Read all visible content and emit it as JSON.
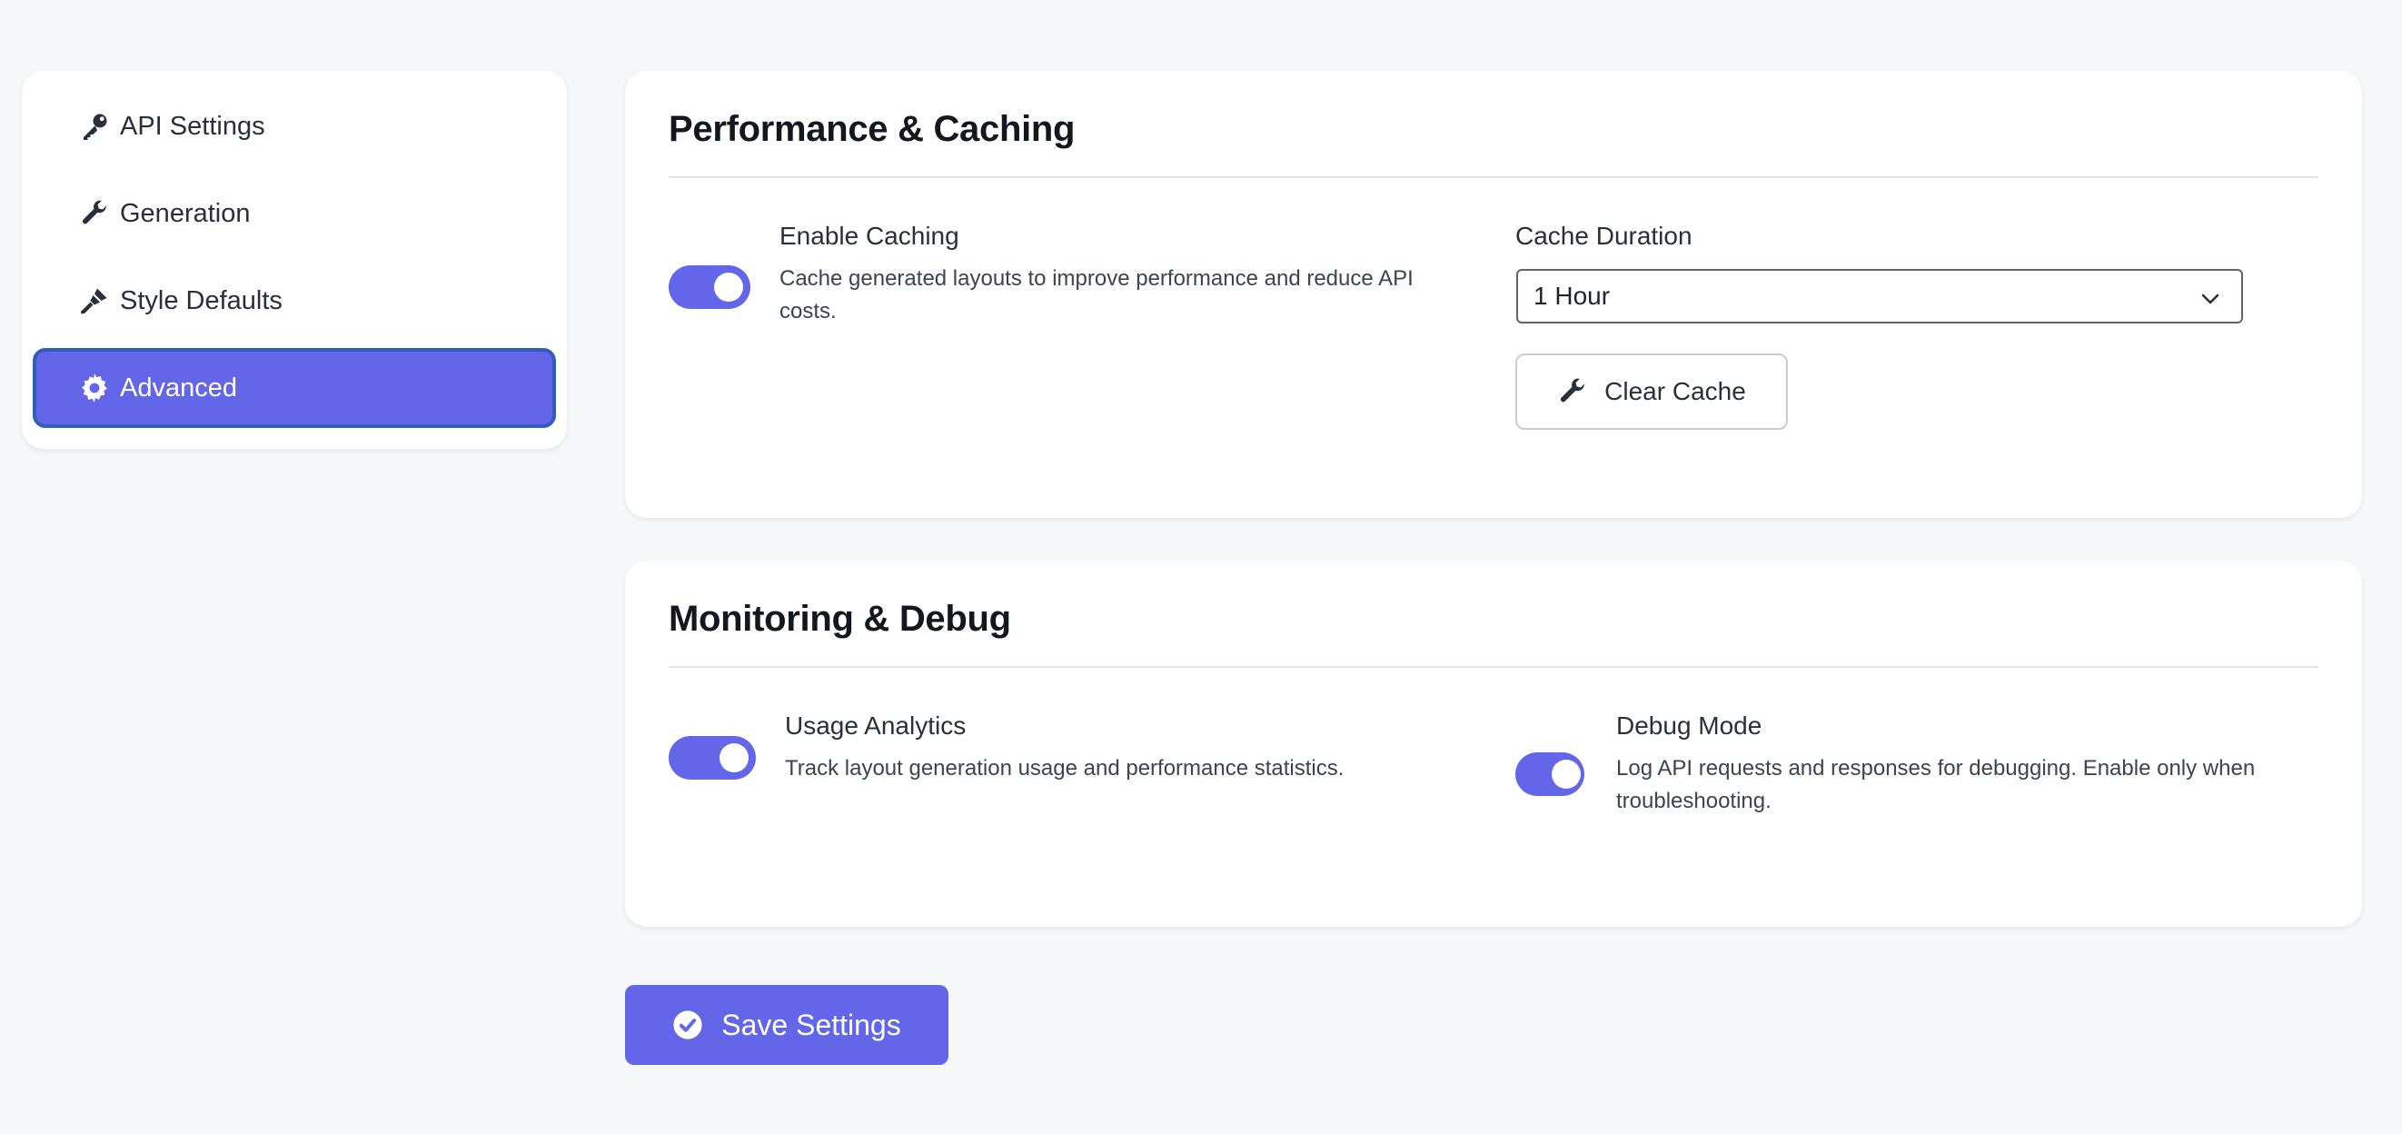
{
  "sidebar": {
    "items": [
      {
        "label": "API Settings",
        "icon": "key-icon",
        "active": false
      },
      {
        "label": "Generation",
        "icon": "wrench-icon",
        "active": false
      },
      {
        "label": "Style Defaults",
        "icon": "paintbrush-icon",
        "active": false
      },
      {
        "label": "Advanced",
        "icon": "gear-icon",
        "active": true
      }
    ]
  },
  "performance": {
    "title": "Performance & Caching",
    "enable_caching": {
      "label": "Enable Caching",
      "description": "Cache generated layouts to improve performance and reduce API costs.",
      "enabled": true
    },
    "cache_duration": {
      "label": "Cache Duration",
      "value": "1 Hour"
    },
    "clear_cache_label": "Clear Cache"
  },
  "monitoring": {
    "title": "Monitoring & Debug",
    "usage_analytics": {
      "label": "Usage Analytics",
      "description": "Track layout generation usage and performance statistics.",
      "enabled": true
    },
    "debug_mode": {
      "label": "Debug Mode",
      "description": "Log API requests and responses for debugging. Enable only when troubleshooting.",
      "enabled": true
    }
  },
  "save_label": "Save Settings",
  "colors": {
    "accent": "#6366e8",
    "background": "#f6f7f9",
    "active_border": "#2f5fb8"
  }
}
